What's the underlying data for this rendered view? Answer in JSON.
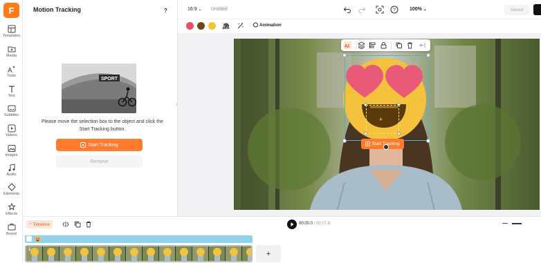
{
  "app": {
    "logo_letter": "F"
  },
  "sidebar": {
    "items": [
      {
        "label": "Templates",
        "icon": "templates-icon"
      },
      {
        "label": "Media",
        "icon": "media-icon"
      },
      {
        "label": "Tools",
        "icon": "tools-icon"
      },
      {
        "label": "Text",
        "icon": "text-icon"
      },
      {
        "label": "Subtitles",
        "icon": "subtitles-icon"
      },
      {
        "label": "Videos",
        "icon": "videos-icon"
      },
      {
        "label": "Images",
        "icon": "images-icon"
      },
      {
        "label": "Audio",
        "icon": "audio-icon"
      },
      {
        "label": "Elements",
        "icon": "elements-icon"
      },
      {
        "label": "Effects",
        "icon": "effects-icon"
      },
      {
        "label": "Brand",
        "icon": "brand-icon"
      }
    ]
  },
  "panel": {
    "title": "Motion Tracking",
    "help": "?",
    "thumbnail_sign": "SPORT",
    "hint": "Please move the selection box to the object and click the Start Tracking button.",
    "start_label": "Start Tracking",
    "remove_label": "Remove"
  },
  "topbar": {
    "aspect": "16:9",
    "title": "Untitled",
    "zoom": "100%",
    "saved_label": "Saved"
  },
  "toolbar": {
    "colors": [
      "#e8506a",
      "#6b4a12",
      "#f4c430"
    ],
    "animation_label": "Animation"
  },
  "canvas": {
    "track_chip_label": "Start Tracking"
  },
  "timeline": {
    "label": "Timeline",
    "current_time": "00:00.0",
    "separator": "/",
    "total_time": "00:07.8",
    "add_label": "+",
    "clip_index": "1"
  }
}
